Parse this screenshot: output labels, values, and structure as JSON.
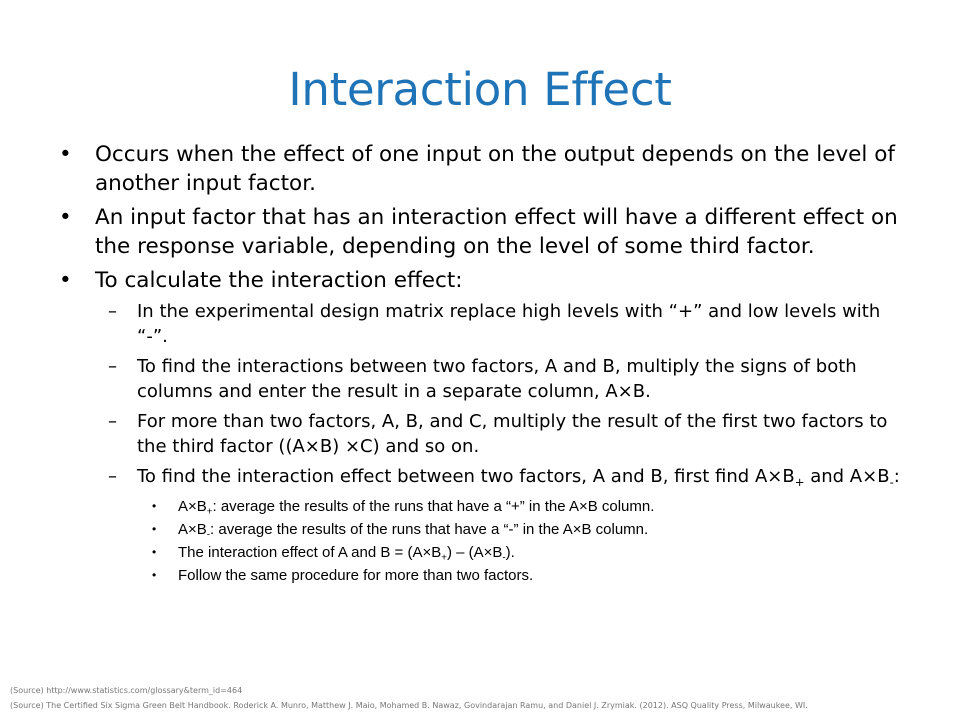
{
  "slide": {
    "title": "Interaction Effect",
    "bullets": [
      {
        "text": "Occurs when the effect of one input on the output depends on the level of another input factor."
      },
      {
        "text": "An input factor that has an interaction effect will have a different effect on the response variable, depending on the level of some third factor."
      },
      {
        "text": "To calculate the interaction effect:"
      }
    ],
    "sub_bullets": [
      {
        "text": "In the experimental design matrix replace high levels with “+” and low levels with “-”."
      },
      {
        "text": "To find the interactions between two factors, A and B, multiply the signs of both columns and enter the result in a separate column, A×B."
      },
      {
        "text": "For more than two factors, A, B, and C, multiply the result of the first two factors to the third factor ((A×B) ×C) and so on."
      },
      {
        "pre": "To find the interaction effect between two factors, A and B, first find A×B",
        "sub1": "+",
        "mid": " and A×B",
        "sub2": "-",
        "post": ":"
      }
    ],
    "sub_sub_bullets": [
      {
        "pre": "A×B",
        "sub": "+",
        "post": ": average the results of the runs that have a “+” in the A×B column."
      },
      {
        "pre": "A×B",
        "sub": "-",
        "post": ": average the results of the runs that have a “-” in the A×B column."
      },
      {
        "pre": "The interaction effect of A and B = (A×B",
        "sub1": "+",
        "mid": ") – (A×B",
        "sub2": "-",
        "post": ")."
      },
      {
        "text": "Follow the same procedure for more than two factors."
      }
    ],
    "bullet_glyphs": {
      "level1": "•",
      "level2": "–",
      "level3": "•"
    },
    "sources": [
      "(Source) http://www.statistics.com/glossary&term_id=464",
      "(Source) The Certified Six Sigma Green Belt Handbook. Roderick A. Munro, Matthew J. Maio, Mohamed B. Nawaz, Govindarajan Ramu, and Daniel J. Zrymiak. (2012). ASQ Quality Press, Milwaukee, WI."
    ],
    "colors": {
      "title": "#1f73b7",
      "text": "#000000",
      "source": "#777777"
    }
  }
}
